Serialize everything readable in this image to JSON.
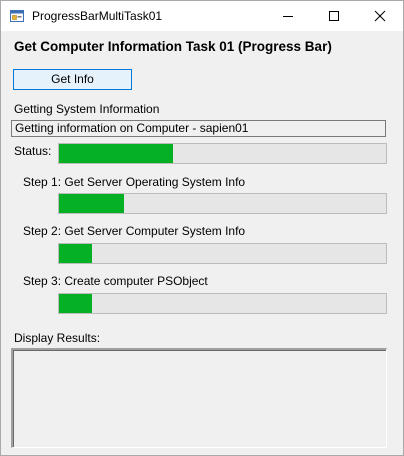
{
  "window": {
    "title": "ProgressBarMultiTask01",
    "icon": "form-app-icon"
  },
  "form": {
    "heading": "Get Computer Information Task 01 (Progress Bar)",
    "get_info_label": "Get Info",
    "section_label": "Getting System Information",
    "status_text": "Getting information on Computer - sapien01",
    "status_label": "Status:",
    "status_progress": 0.35,
    "steps": [
      {
        "label": "Step 1: Get Server Operating System Info",
        "progress": 0.2
      },
      {
        "label": "Step 2: Get Server Computer System Info",
        "progress": 0.1
      },
      {
        "label": "Step 3: Create computer PSObject",
        "progress": 0.1
      }
    ],
    "results_label": "Display Results:",
    "results_text": ""
  },
  "colors": {
    "progress_fill": "#06b025",
    "progress_track": "#e6e6e6",
    "button_focus_border": "#0078d7"
  }
}
